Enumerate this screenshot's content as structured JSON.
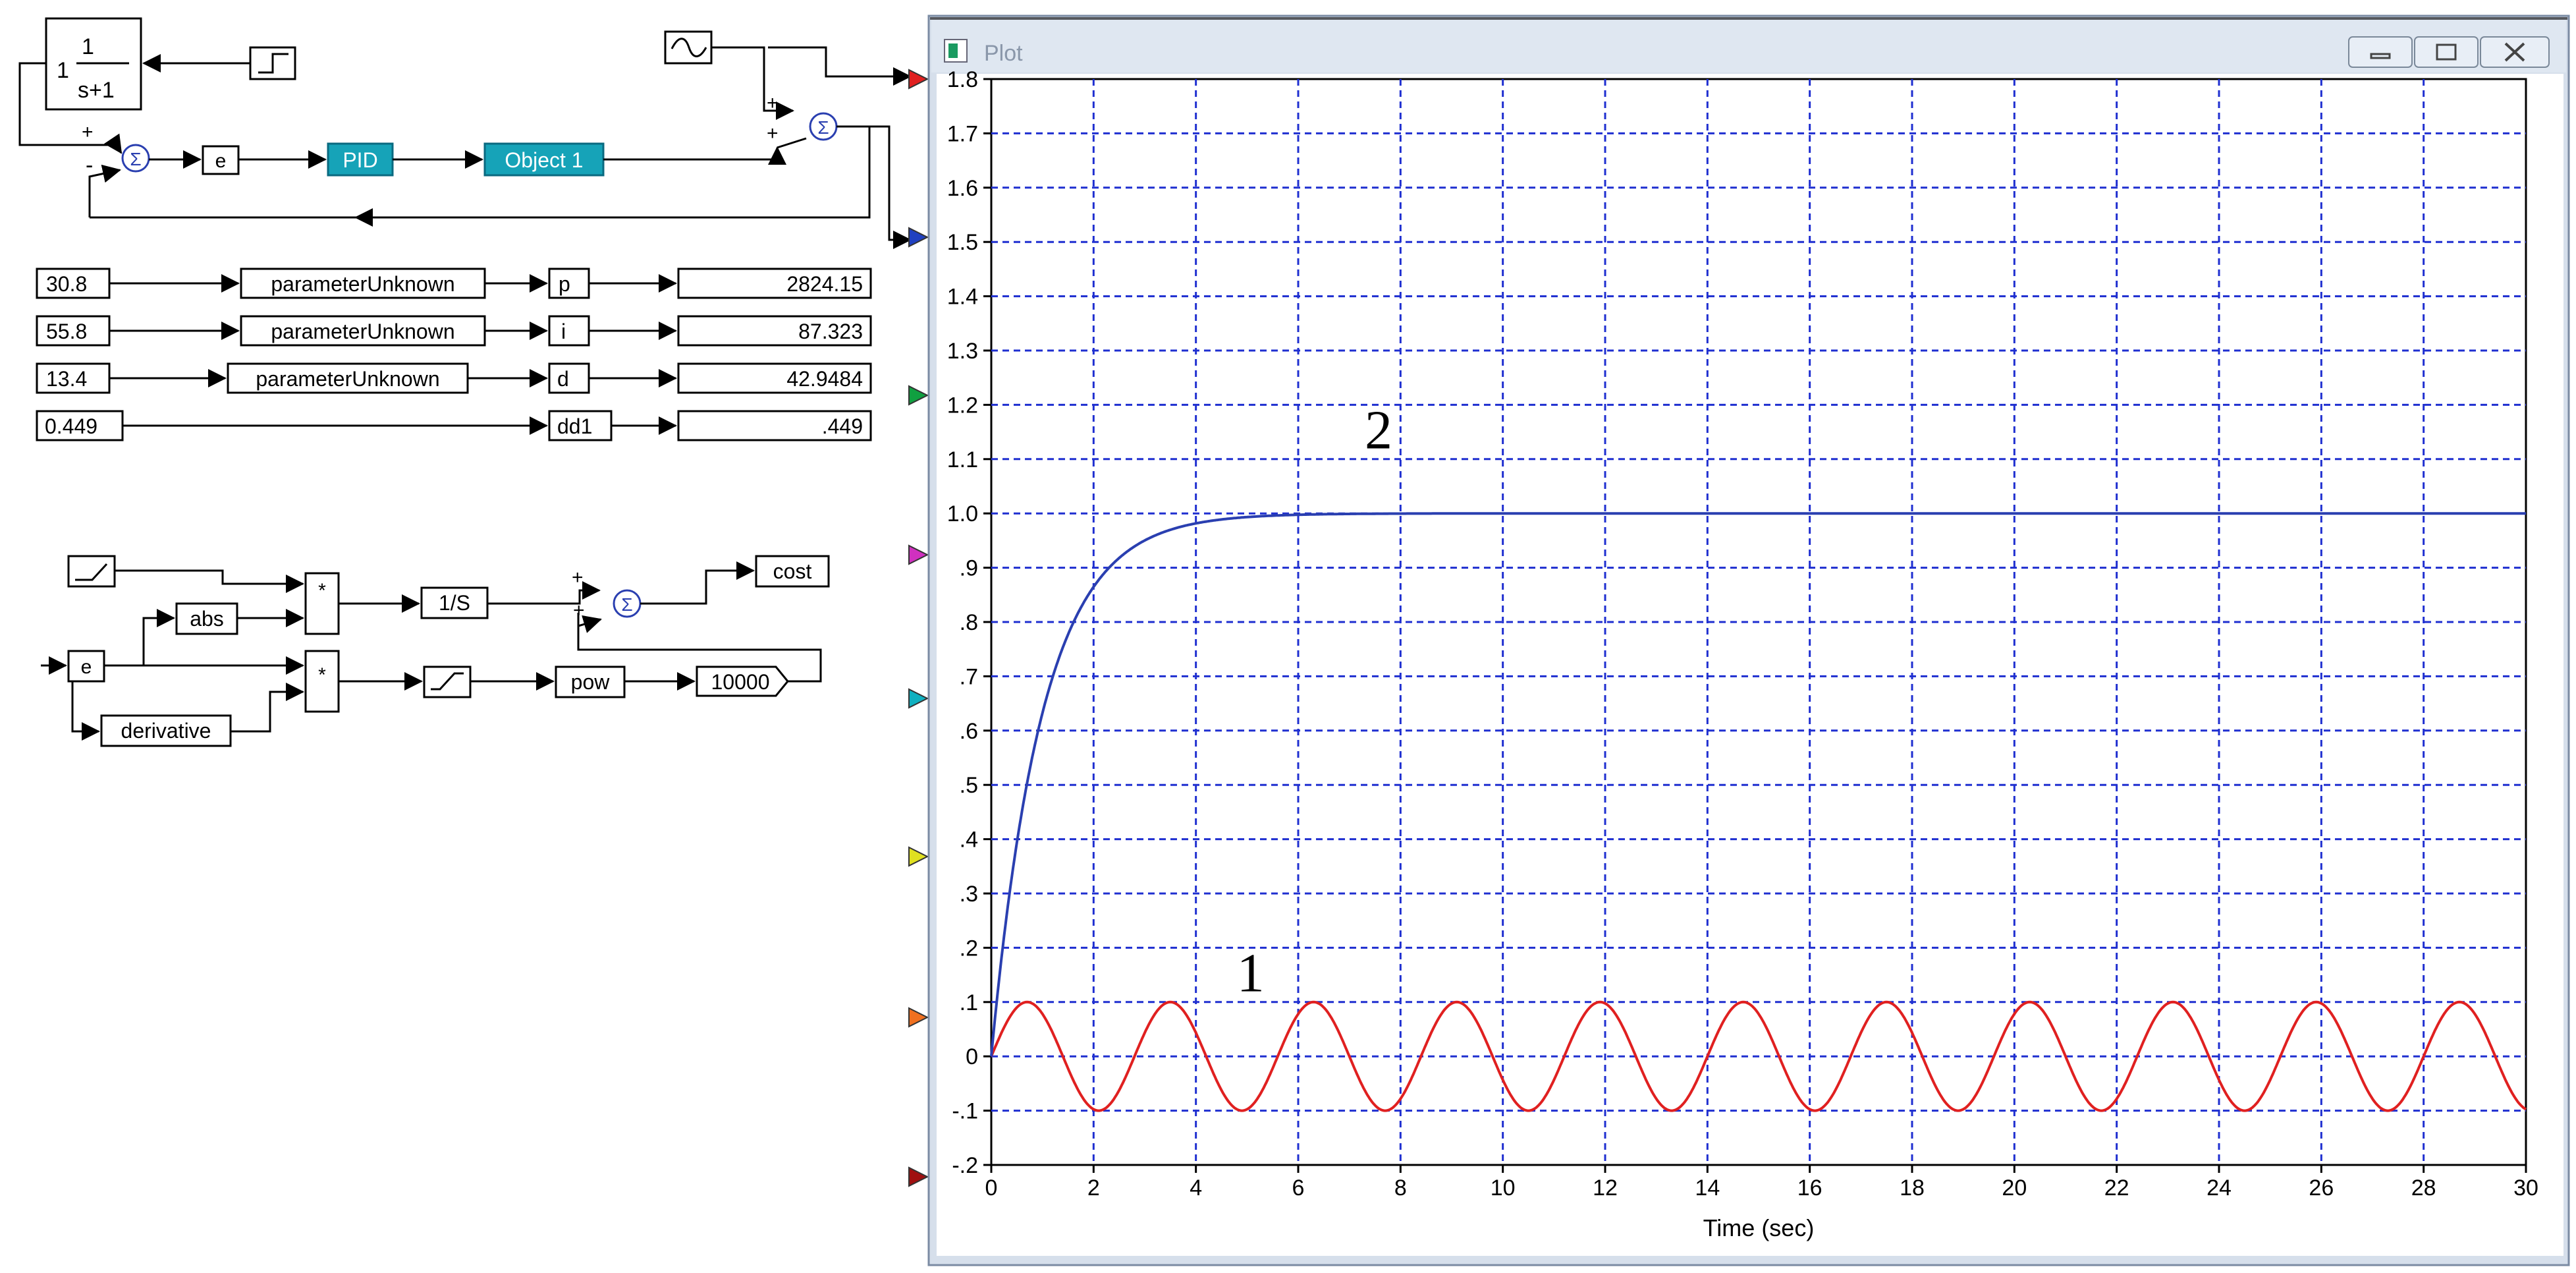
{
  "diagram": {
    "transfer_fn": {
      "gain": "1",
      "numerator": "1",
      "denominator": "s+1"
    },
    "blocks": {
      "e_top": "e",
      "pid": "PID",
      "object": "Object 1",
      "e_bottom": "e",
      "abs": "abs",
      "derivative": "derivative",
      "mult": "*",
      "integrator": "1/S",
      "pow": "pow",
      "cost": "cost",
      "const_10000": "10000",
      "sum_symbol": "Σ",
      "plus": "+",
      "minus": "-"
    },
    "param_rows": [
      {
        "input": "30.8",
        "block": "parameterUnknown",
        "name": "p",
        "value": "2824.15"
      },
      {
        "input": "55.8",
        "block": "parameterUnknown",
        "name": "i",
        "value": "87.323"
      },
      {
        "input": "13.4",
        "block": "parameterUnknown",
        "name": "d",
        "value": "42.9484"
      },
      {
        "input": "0.449",
        "block": "",
        "name": "dd1",
        "value": ".449"
      }
    ]
  },
  "plot_window": {
    "title": "Plot",
    "controls": {
      "minimize": "minimize",
      "maximize": "maximize",
      "close": "close"
    },
    "input_port_colors": [
      "#e02020",
      "#2040c0",
      "#10a040",
      "#d030c0",
      "#10b0c0",
      "#e0e020",
      "#f07020",
      "#a01010"
    ]
  },
  "chart_data": {
    "type": "line",
    "xlabel": "Time (sec)",
    "ylabel": "",
    "xlim": [
      0,
      30
    ],
    "ylim": [
      -0.2,
      1.8
    ],
    "xticks": [
      "0",
      "2",
      "4",
      "6",
      "8",
      "10",
      "12",
      "14",
      "16",
      "18",
      "20",
      "22",
      "24",
      "26",
      "28",
      "30"
    ],
    "yticks": [
      "-.2",
      "-.1",
      "0",
      ".1",
      ".2",
      ".3",
      ".4",
      ".5",
      ".6",
      ".7",
      ".8",
      ".9",
      "1.0",
      "1.1",
      "1.2",
      "1.3",
      "1.4",
      "1.5",
      "1.6",
      "1.7",
      "1.8"
    ],
    "grid": true,
    "annotations": [
      {
        "text": "1",
        "x": 4.8,
        "y": 0.12
      },
      {
        "text": "2",
        "x": 7.3,
        "y": 1.12
      }
    ],
    "series": [
      {
        "color": "#e02020",
        "function": "0.1*sin(2*pi*t/2.8)",
        "x": [
          0,
          0.7,
          1.4,
          2.1,
          2.8,
          3.5,
          4.2,
          4.9,
          5.6,
          6.3,
          7.0,
          7.7,
          8.4,
          9.1,
          9.8,
          10.5,
          11.2,
          11.9,
          12.6,
          13.3,
          14.0,
          14.7,
          15.4,
          16.1,
          16.8,
          17.5,
          18.2,
          18.9,
          19.6,
          20.3,
          21.0,
          21.7,
          22.4,
          23.1,
          23.8,
          24.5,
          25.2,
          25.9,
          26.6,
          27.3,
          28.0,
          28.7,
          29.4,
          30.0
        ],
        "y": [
          0,
          0.1,
          0,
          -0.1,
          0,
          0.1,
          0,
          -0.1,
          0,
          0.1,
          0,
          -0.1,
          0,
          0.1,
          0,
          -0.1,
          0,
          0.1,
          0,
          -0.1,
          0,
          0.1,
          0,
          -0.1,
          0,
          0.1,
          0,
          -0.1,
          0,
          0.1,
          0,
          -0.1,
          0,
          0.1,
          0,
          -0.1,
          0,
          0.1,
          0,
          -0.1,
          0,
          0.1,
          0,
          -0.1
        ]
      },
      {
        "color": "#2a3fb0",
        "function": "1-exp(-t)",
        "x": [
          0,
          0.1,
          0.25,
          0.5,
          0.75,
          1,
          1.5,
          2,
          2.5,
          3,
          4,
          5,
          6,
          7,
          30
        ],
        "y": [
          0,
          0.095,
          0.221,
          0.393,
          0.528,
          0.632,
          0.777,
          0.865,
          0.918,
          0.95,
          0.982,
          0.993,
          0.998,
          0.999,
          1.0
        ]
      }
    ]
  }
}
